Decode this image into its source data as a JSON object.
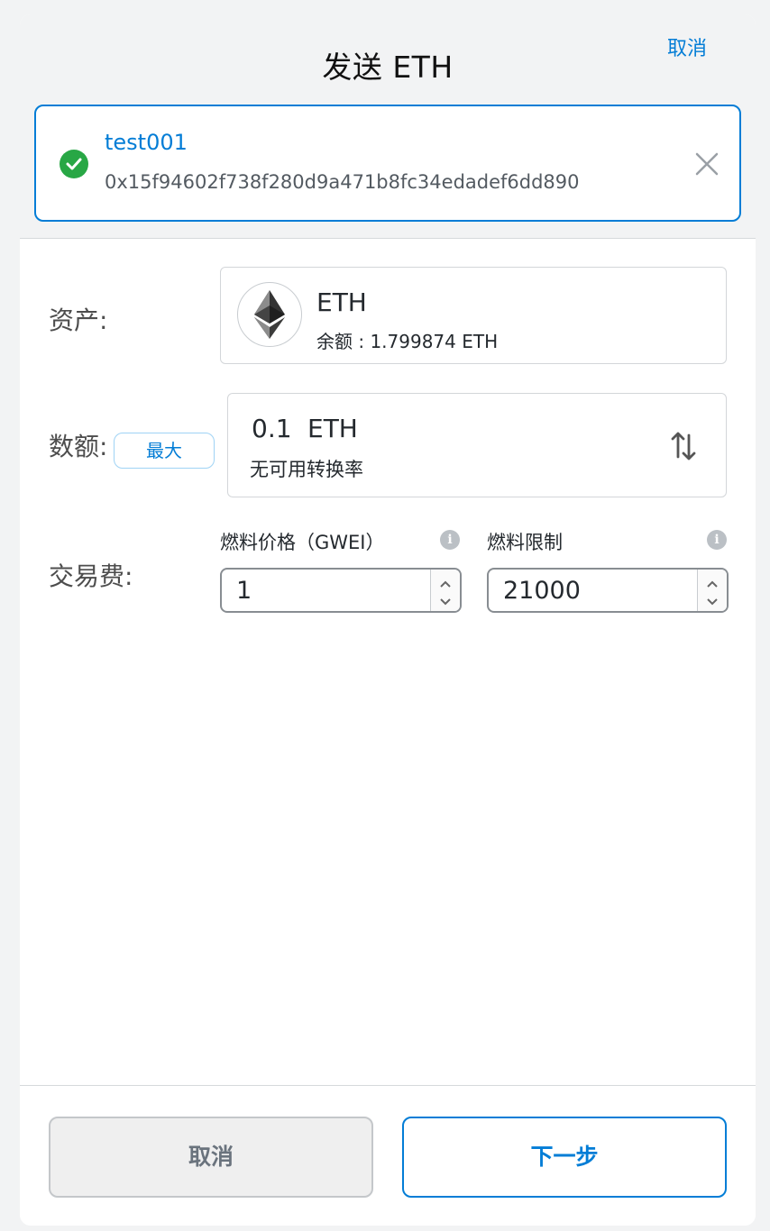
{
  "header": {
    "title": "发送 ETH",
    "cancel_label": "取消"
  },
  "recipient": {
    "name": "test001",
    "address": "0x15f94602f738f280d9a471b8fc34edadef6dd890"
  },
  "asset": {
    "label": "资产:",
    "symbol": "ETH",
    "balance_text": "余额 : 1.799874 ETH"
  },
  "amount": {
    "label": "数额:",
    "max_label": "最大",
    "value": "0.1",
    "unit": "ETH",
    "conversion_text": "无可用转换率"
  },
  "fee": {
    "label": "交易费:",
    "gas_price_label": "燃料价格（GWEI）",
    "gas_price_value": "1",
    "gas_limit_label": "燃料限制",
    "gas_limit_value": "21000"
  },
  "footer": {
    "cancel_label": "取消",
    "next_label": "下一步"
  },
  "colors": {
    "accent": "#037dd6",
    "success": "#28a745",
    "muted_bg": "#f2f3f4"
  },
  "icons": [
    "check-circle-icon",
    "close-icon",
    "ethereum-icon",
    "swap-icon",
    "info-icon",
    "chevron-up-icon",
    "chevron-down-icon"
  ]
}
